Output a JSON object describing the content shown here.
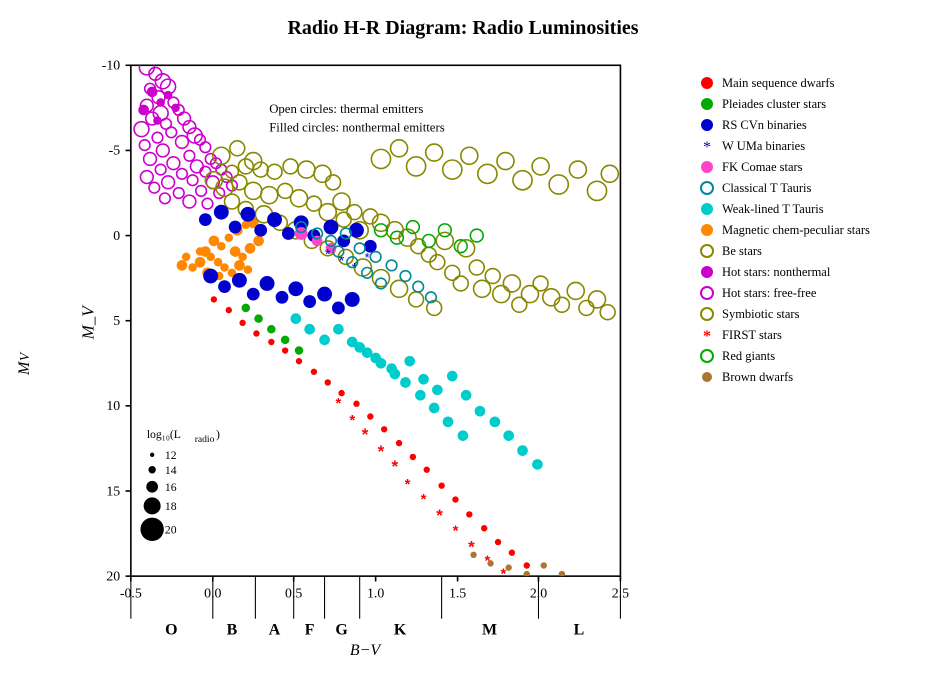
{
  "title": "Radio H-R Diagram: Radio Luminosities",
  "axes": {
    "x_label": "B−V",
    "y_label": "M_v",
    "x_min": -0.5,
    "x_max": 2.5,
    "y_min": -10,
    "y_max": 20,
    "x_ticks": [
      -0.5,
      0.0,
      0.5,
      1.0,
      1.5,
      2.0,
      2.5
    ],
    "y_ticks": [
      -10,
      -5,
      0,
      5,
      10,
      15,
      20
    ]
  },
  "annotations": {
    "open_circles": "Open circles: thermal emitters",
    "filled_circles": "Filled circles: nonthermal emitters"
  },
  "size_legend": {
    "title": "log₁₀(L_radio)",
    "entries": [
      {
        "value": 12,
        "size": 3
      },
      {
        "value": 14,
        "size": 5
      },
      {
        "value": 16,
        "size": 8
      },
      {
        "value": 18,
        "size": 11
      },
      {
        "value": 20,
        "size": 15
      }
    ]
  },
  "spectral_classes": [
    "O",
    "B",
    "A",
    "F",
    "G",
    "K",
    "M",
    "L"
  ],
  "legend_items": [
    {
      "label": "Main sequence dwarfs",
      "color": "#ff0000",
      "type": "filled_circle"
    },
    {
      "label": "Pleiades cluster stars",
      "color": "#00aa00",
      "type": "filled_circle"
    },
    {
      "label": "RS CVn binaries",
      "color": "#0000cc",
      "type": "filled_circle"
    },
    {
      "label": "W UMa binaries",
      "color": "#0000cc",
      "type": "asterisk"
    },
    {
      "label": "FK Comae stars",
      "color": "#ff00ff",
      "type": "filled_circle"
    },
    {
      "label": "Classical T Tauris",
      "color": "#00aaaa",
      "type": "open_circle"
    },
    {
      "label": "Weak-lined T Tauris",
      "color": "#00cccc",
      "type": "filled_circle"
    },
    {
      "label": "Magnetic chem-peculiar stars",
      "color": "#ff8800",
      "type": "filled_circle"
    },
    {
      "label": "Be stars",
      "color": "#aaaa00",
      "type": "open_circle"
    },
    {
      "label": "Hot stars: nonthermal",
      "color": "#cc00cc",
      "type": "filled_circle"
    },
    {
      "label": "Hot stars: free-free",
      "color": "#cc00cc",
      "type": "open_circle"
    },
    {
      "label": "Symbiotic stars",
      "color": "#aaaa00",
      "type": "open_circle"
    },
    {
      "label": "FIRST stars",
      "color": "#ff0000",
      "type": "asterisk"
    },
    {
      "label": "Red giants",
      "color": "#00aa00",
      "type": "open_circle"
    },
    {
      "label": "Brown dwarfs",
      "color": "#aa7733",
      "type": "filled_circle"
    }
  ]
}
